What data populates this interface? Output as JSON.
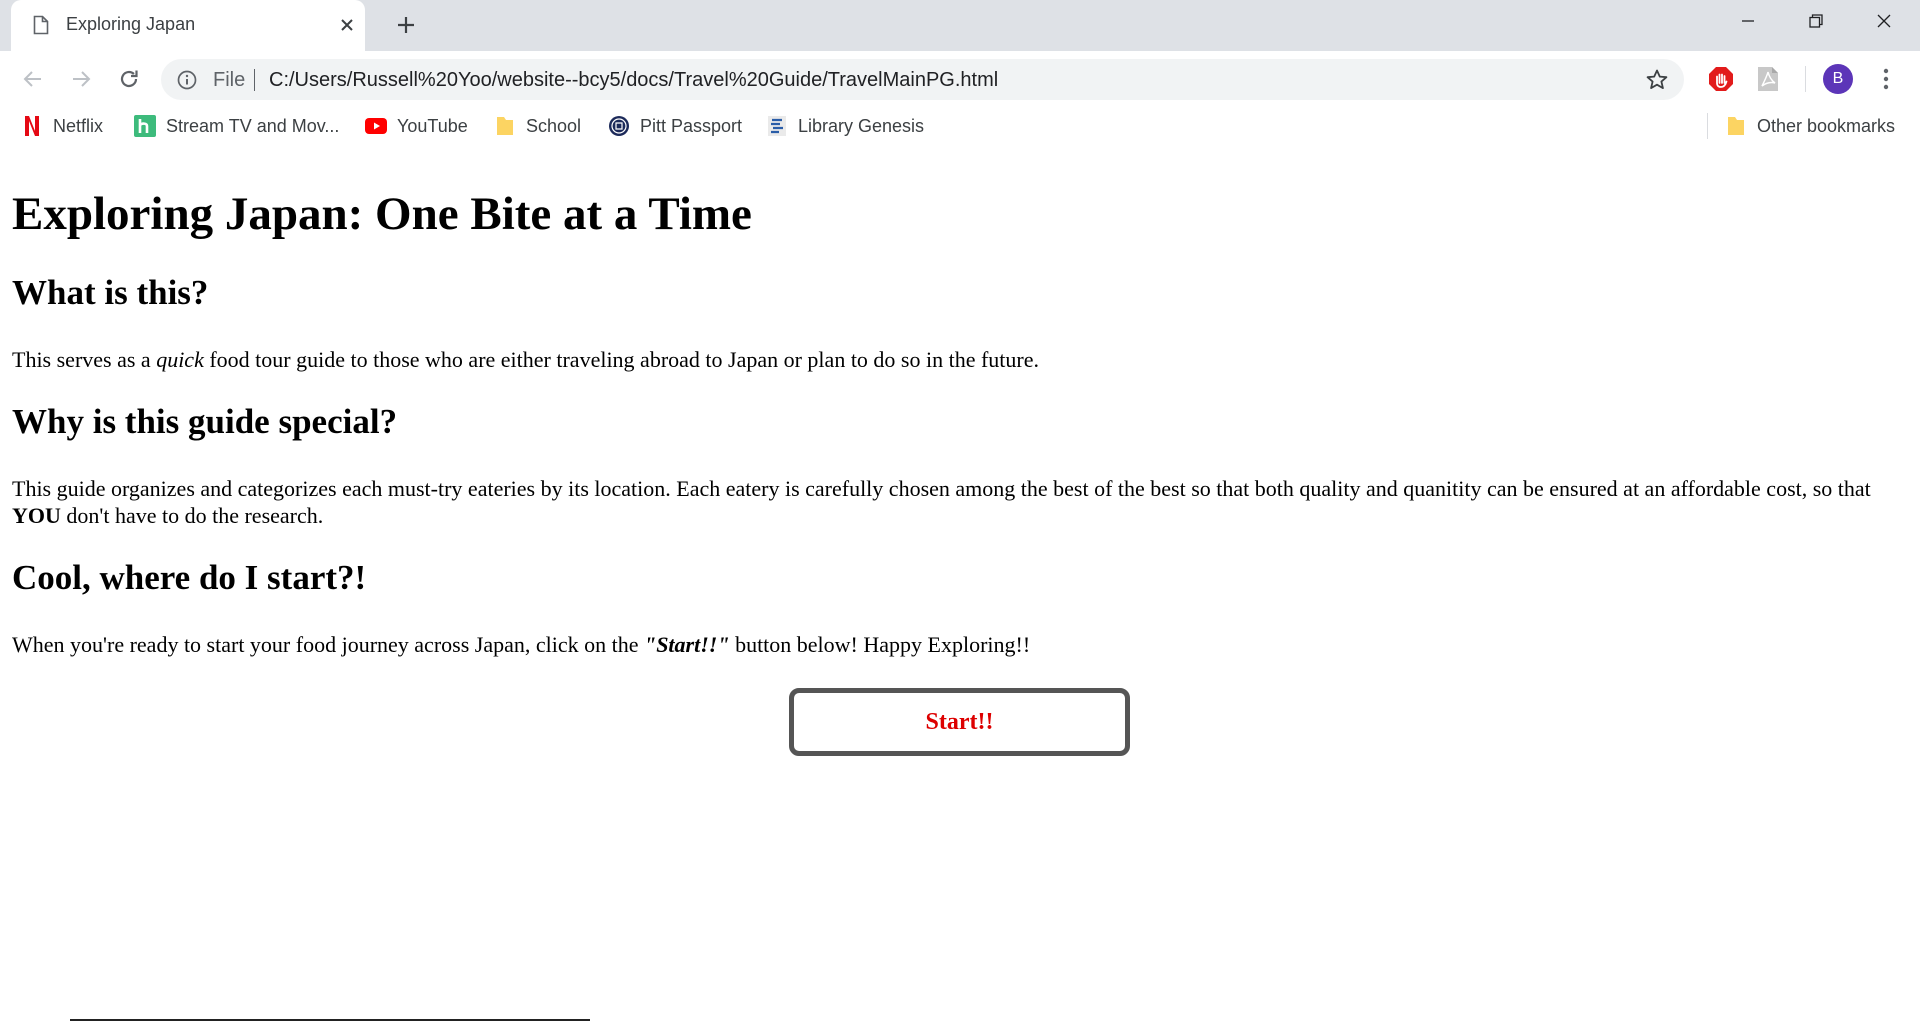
{
  "browser": {
    "tab_title": "Exploring Japan",
    "omnibox": {
      "scheme_label": "File",
      "url": "C:/Users/Russell%20Yoo/website--bcy5/docs/Travel%20Guide/TravelMainPG.html"
    },
    "profile_initial": "B",
    "icons": {
      "back": "arrow-left-icon",
      "forward": "arrow-right-icon",
      "reload": "reload-icon",
      "info": "info-icon",
      "bookmark_star": "star-icon",
      "menu": "vertical-dots-icon"
    },
    "colors": {
      "tabstrip": "#dee1e6",
      "omnibox": "#f1f3f4",
      "avatar": "#5c35b8"
    }
  },
  "bookmarks": {
    "items": [
      {
        "label": "Netflix",
        "icon": "netflix-icon"
      },
      {
        "label": "Stream TV and Mov...",
        "icon": "hulu-icon"
      },
      {
        "label": "YouTube",
        "icon": "youtube-icon"
      },
      {
        "label": "School",
        "icon": "folder-icon"
      },
      {
        "label": "Pitt Passport",
        "icon": "pitt-icon"
      },
      {
        "label": "Library Genesis",
        "icon": "library-icon"
      }
    ],
    "other": {
      "label": "Other bookmarks",
      "icon": "folder-icon"
    }
  },
  "page": {
    "title": "Exploring Japan: One Bite at a Time",
    "section1": {
      "heading": "What is this?",
      "text_before": "This serves as a ",
      "text_em": "quick",
      "text_after": " food tour guide to those who are either traveling abroad to Japan or plan to do so in the future."
    },
    "section2": {
      "heading": "Why is this guide special?",
      "text_before": "This guide organizes and categorizes each must-try eateries by its location. Each eatery is carefully chosen among the best of the best so that both quality and quanitity can be ensured at an affordable cost, so that ",
      "text_strong": "YOU",
      "text_after": " don't have to do the research."
    },
    "section3": {
      "heading": "Cool, where do I start?!",
      "text_before": "When you're ready to start your food journey across Japan, click on the ",
      "text_em_strong": "\"Start!!\"",
      "text_after": " button below! Happy Exploring!!"
    },
    "start_button": "Start!!",
    "colors": {
      "start_text": "#dd0000",
      "start_border": "#555555"
    }
  }
}
